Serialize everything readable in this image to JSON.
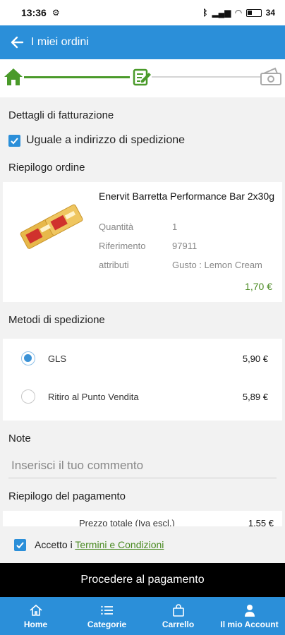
{
  "status": {
    "time": "13:36",
    "battery": "34"
  },
  "header": {
    "title": "I miei ordini"
  },
  "billing": {
    "title": "Dettagli di fatturazione",
    "same_address_label": "Uguale a indirizzo di spedizione"
  },
  "summary": {
    "title": "Riepilogo ordine",
    "product": {
      "name": "Enervit Barretta Performance Bar 2x30g",
      "qty_label": "Quantità",
      "qty_value": "1",
      "ref_label": "Riferimento",
      "ref_value": "97911",
      "attr_label": "attributi",
      "attr_value": "Gusto : Lemon Cream",
      "price": "1,70 €"
    }
  },
  "shipping": {
    "title": "Metodi di spedizione",
    "options": [
      {
        "label": "GLS",
        "price": "5,90 €",
        "selected": true
      },
      {
        "label": "Ritiro al Punto Vendita",
        "price": "5,89 €",
        "selected": false
      }
    ]
  },
  "note": {
    "title": "Note",
    "placeholder": "Inserisci il tuo commento"
  },
  "payment": {
    "title": "Riepilogo del pagamento",
    "total_label": "Prezzo totale (Iva escl.)",
    "total_value": "1,55 €"
  },
  "terms": {
    "prefix": "Accetto i",
    "link": "Termini e Condizioni"
  },
  "cta": {
    "label": "Procedere al pagamento"
  },
  "nav": {
    "items": [
      {
        "label": "Home",
        "icon": "home-icon"
      },
      {
        "label": "Categorie",
        "icon": "list-icon"
      },
      {
        "label": "Carrello",
        "icon": "bag-icon"
      },
      {
        "label": "Il mio Account",
        "icon": "user-icon"
      }
    ]
  },
  "colors": {
    "primary": "#2b8fd9",
    "accent_green": "#4a9a2a",
    "price_green": "#4a8a22",
    "cta_bg": "#000000"
  }
}
